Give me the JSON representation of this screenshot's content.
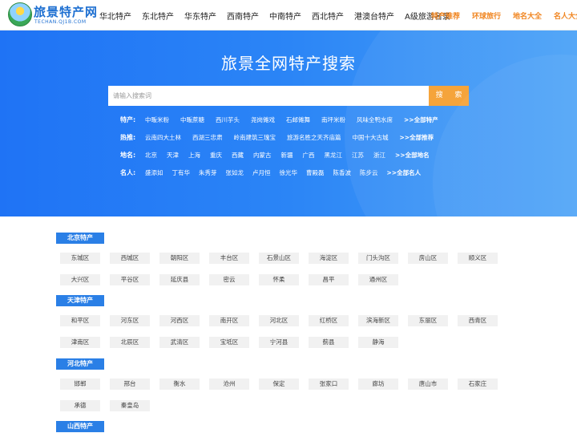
{
  "header": {
    "logo_title": "旅景特产网",
    "logo_sub": "TECHAN.QJ1B.COM",
    "nav": [
      "华北特产",
      "东北特产",
      "华东特产",
      "西南特产",
      "中南特产",
      "西北特产",
      "港澳台特产",
      "A级旅游名录"
    ],
    "hot_links": [
      "特产推荐",
      "环球旅行",
      "地名大全",
      "名人大全"
    ]
  },
  "banner": {
    "title": "旅景全网特产搜索",
    "search_placeholder": "请输入搜索词",
    "search_button": "搜 索",
    "rows": [
      {
        "label": "特产:",
        "tags": [
          "中畈米粉",
          "中畈蔗糖",
          "西川芋头",
          "尧岗傩戏",
          "石邮傩舞",
          "南坪米粉",
          "风味全鸭水席"
        ],
        "more": ">>全部特产"
      },
      {
        "label": "热推:",
        "tags": [
          "云南四大土林",
          "西湖三忠肃",
          "岭南建筑三瑰宝",
          "旅游名胜之天齐庙篇",
          "中国十大古城"
        ],
        "more": ">>全部推荐"
      },
      {
        "label": "地名:",
        "tags": [
          "北京",
          "天津",
          "上海",
          "重庆",
          "西藏",
          "内蒙古",
          "新疆",
          "广西",
          "黑龙江",
          "江苏",
          "浙江"
        ],
        "more": ">>全部地名"
      },
      {
        "label": "名人:",
        "tags": [
          "盛添如",
          "丁有华",
          "朱秀芽",
          "张如龙",
          "卢月恒",
          "徐光华",
          "曹殿磊",
          "陈香波",
          "陈步云"
        ],
        "more": ">>全部名人"
      }
    ]
  },
  "regions": [
    {
      "name": "北京特产",
      "items": [
        "东城区",
        "西城区",
        "朝阳区",
        "丰台区",
        "石景山区",
        "海淀区",
        "门头沟区",
        "房山区",
        "顺义区",
        "大兴区",
        "平谷区",
        "延庆县",
        "密云",
        "怀柔",
        "昌平",
        "通州区"
      ]
    },
    {
      "name": "天津特产",
      "items": [
        "和平区",
        "河东区",
        "河西区",
        "南开区",
        "河北区",
        "红桥区",
        "滨海新区",
        "东丽区",
        "西青区",
        "津南区",
        "北辰区",
        "武清区",
        "宝坻区",
        "宁河县",
        "蓟县",
        "静海"
      ]
    },
    {
      "name": "河北特产",
      "items": [
        "邯郸",
        "邢台",
        "衡水",
        "沧州",
        "保定",
        "张家口",
        "廊坊",
        "唐山市",
        "石家庄",
        "承德",
        "秦皇岛"
      ]
    },
    {
      "name": "山西特产",
      "items": []
    }
  ]
}
